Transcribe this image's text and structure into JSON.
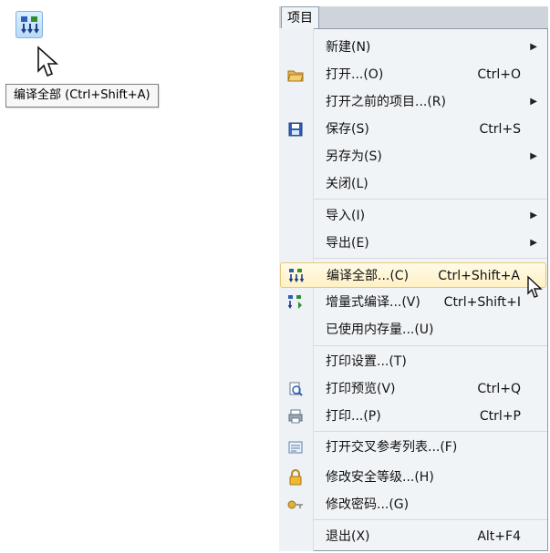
{
  "toolbar": {
    "compile_all_icon": "compile-all-icon",
    "tooltip": "编译全部 (Ctrl+Shift+A)"
  },
  "menu": {
    "title": "项目",
    "items": [
      {
        "label": "新建(N)",
        "shortcut": "",
        "submenu": true,
        "icon": ""
      },
      {
        "label": "打开...(O)",
        "shortcut": "Ctrl+O",
        "submenu": false,
        "icon": "folder-open-icon"
      },
      {
        "label": "打开之前的项目...(R)",
        "shortcut": "",
        "submenu": true,
        "icon": ""
      },
      {
        "label": "保存(S)",
        "shortcut": "Ctrl+S",
        "submenu": false,
        "icon": "save-icon"
      },
      {
        "label": "另存为(S)",
        "shortcut": "",
        "submenu": true,
        "icon": ""
      },
      {
        "label": "关闭(L)",
        "shortcut": "",
        "submenu": false,
        "icon": ""
      },
      {
        "label": "导入(I)",
        "shortcut": "",
        "submenu": true,
        "icon": ""
      },
      {
        "label": "导出(E)",
        "shortcut": "",
        "submenu": true,
        "icon": ""
      },
      {
        "label": "编译全部...(C)",
        "shortcut": "Ctrl+Shift+A",
        "submenu": false,
        "icon": "compile-all-icon"
      },
      {
        "label": "增量式编译...(V)",
        "shortcut": "Ctrl+Shift+I",
        "submenu": false,
        "icon": "incremental-compile-icon"
      },
      {
        "label": "已使用内存量...(U)",
        "shortcut": "",
        "submenu": false,
        "icon": ""
      },
      {
        "label": "打印设置...(T)",
        "shortcut": "",
        "submenu": false,
        "icon": ""
      },
      {
        "label": "打印预览(V)",
        "shortcut": "Ctrl+Q",
        "submenu": false,
        "icon": "print-preview-icon"
      },
      {
        "label": "打印...(P)",
        "shortcut": "Ctrl+P",
        "submenu": false,
        "icon": "printer-icon"
      },
      {
        "label": "打开交叉参考列表...(F)",
        "shortcut": "",
        "submenu": false,
        "icon": "cross-reference-icon"
      },
      {
        "label": "修改安全等级...(H)",
        "shortcut": "",
        "submenu": false,
        "icon": "lock-icon"
      },
      {
        "label": "修改密码...(G)",
        "shortcut": "",
        "submenu": false,
        "icon": "key-icon"
      },
      {
        "label": "退出(X)",
        "shortcut": "Alt+F4",
        "submenu": false,
        "icon": ""
      }
    ]
  },
  "colors": {
    "menu_bg": "#f1f4f7",
    "hover_bg": "#fff1c4",
    "hover_border": "#e8c77a"
  }
}
